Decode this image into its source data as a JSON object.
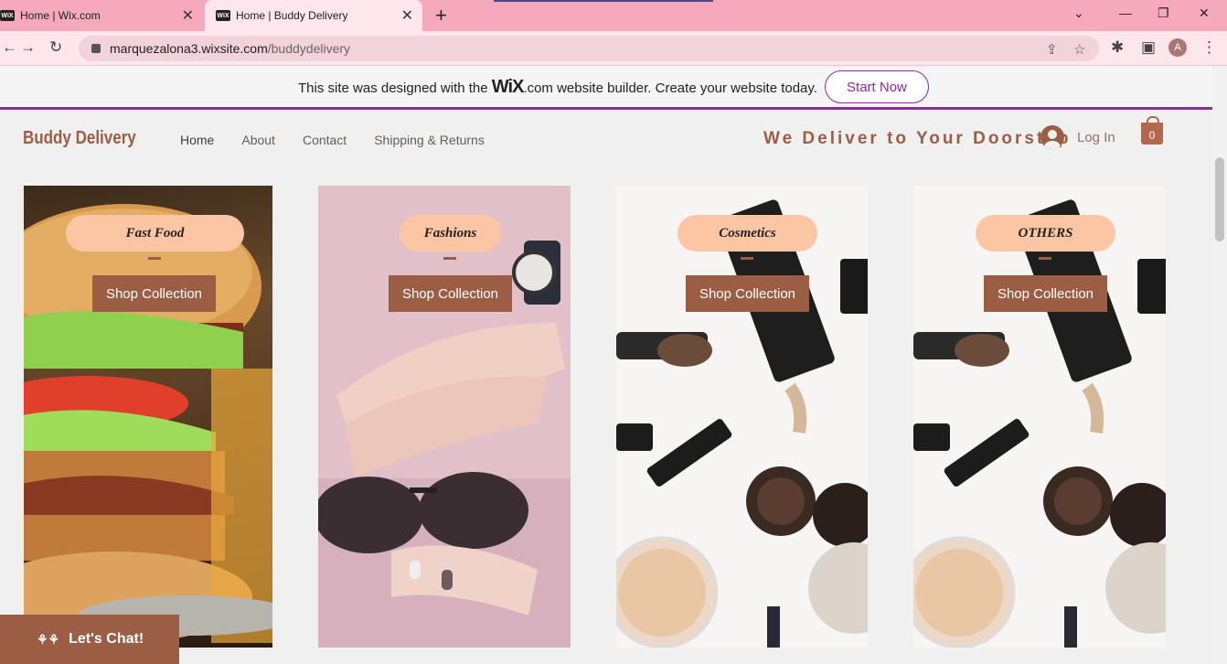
{
  "browser": {
    "tabs": [
      {
        "label": "Home | Wix.com",
        "favicon": "WiX"
      },
      {
        "label": "Home | Buddy Delivery",
        "favicon": "WiX"
      }
    ],
    "url_host": "marquezalona3.wixsite.com",
    "url_path": "/buddydelivery",
    "profile_initial": "A"
  },
  "wix_banner": {
    "text_before": "This site was designed with the",
    "brand": "WiX",
    "text_after": ".com website builder. Create your website today.",
    "button": "Start Now"
  },
  "site": {
    "brand": "Buddy Delivery",
    "menu": [
      "Home",
      "About",
      "Contact",
      "Shipping & Returns"
    ],
    "tagline": "We Deliver to Your Doorstep",
    "login": "Log In",
    "cart_count": "0"
  },
  "cards": [
    {
      "title": "Fast Food",
      "button": "Shop Collection"
    },
    {
      "title": "Fashions",
      "button": "Shop Collection"
    },
    {
      "title": "Cosmetics",
      "button": "Shop Collection"
    },
    {
      "title": "OTHERS",
      "button": "Shop Collection"
    }
  ],
  "chat": {
    "label": "Let's Chat!"
  }
}
